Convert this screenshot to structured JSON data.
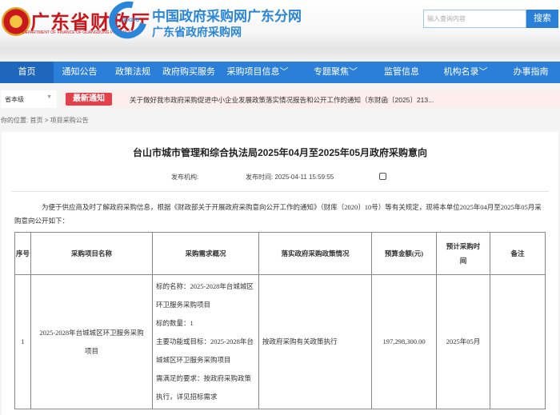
{
  "header": {
    "brand": "广东省财政厅",
    "brand_en": "DEPARTMENT OF FINANCE OF GUANGDONG PROVINCE",
    "logo_text": "GDGPO",
    "title1": "中国政府采购网广东分网",
    "title2": "广东省政府采购网",
    "search_placeholder": "输入查询内容",
    "search_button": "搜索"
  },
  "nav": [
    {
      "label": "首页"
    },
    {
      "label": "通知公告"
    },
    {
      "label": "政策法规"
    },
    {
      "label": "政府购买服务"
    },
    {
      "label": "采购项目信息﹀"
    },
    {
      "label": "专题聚焦﹀"
    },
    {
      "label": "监管信息"
    },
    {
      "label": "机构名录﹀"
    },
    {
      "label": "办事指南"
    }
  ],
  "notice": {
    "level": "省本级",
    "badge": "最新通知",
    "text": "关于做好我市政府采购促进中小企业发展政策落实情况报告和公开工作的通知（东财函〔2025〕213..."
  },
  "breadcrumb": {
    "label": "你的位置:",
    "home": "首页",
    "sep": ">",
    "current": "项目采购公告"
  },
  "article": {
    "title": "台山市城市管理和综合执法局2025年04月至2025年05月政府采购意向",
    "publisher_label": "发布机构:",
    "time_label": "发布时间:",
    "time": "2025-04-11 15:59:55",
    "intro": "为便于供应商及时了解政府采购信息，根据《财政部关于开展政府采购意向公开工作的通知》（财库〔2020〕10号）等有关规定，现将本单位2025年04月至2025年05月采购意向公开如下："
  },
  "table": {
    "headers": [
      "序号",
      "采购项目名称",
      "采购需求概况",
      "落实政府采购政策情况",
      "预算金额(元)",
      "预计采购时间",
      "备注"
    ],
    "rows": [
      {
        "no": "1",
        "name": "2025-2028年台城城区环卫服务采购项目",
        "summary": [
          "标的名称：2025-2028年台城城区环卫服务采购项目",
          "标的数量：1",
          "主要功能或目标：2025-2028年台城城区环卫服务采购项目",
          "需满足的要求：按政府采购政策执行，详见招标需求"
        ],
        "policy": "按政府采购有关政策执行",
        "budget": "197,298,300.00",
        "time": "2025年05月",
        "note": ""
      }
    ]
  }
}
